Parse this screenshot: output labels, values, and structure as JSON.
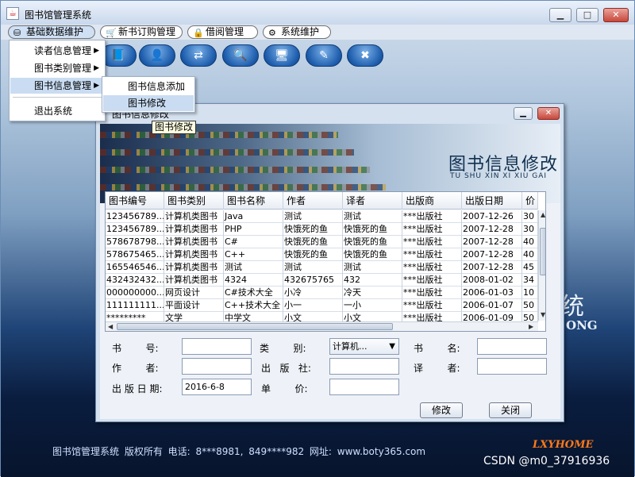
{
  "window": {
    "title": "图书馆管理系统",
    "min_icon": "minimize-icon",
    "max_icon": "maximize-icon",
    "close_icon": "close-icon"
  },
  "menubar": [
    {
      "label": "基础数据维护",
      "icon": "database-icon"
    },
    {
      "label": "新书订购管理",
      "icon": "cart-icon"
    },
    {
      "label": "借阅管理",
      "icon": "lock-icon"
    },
    {
      "label": "系统维护",
      "icon": "gear-icon"
    }
  ],
  "dropdown": {
    "items": [
      "读者信息管理",
      "图书类别管理",
      "图书信息管理",
      "退出系统"
    ],
    "submenu": [
      "图书信息添加",
      "图书修改"
    ]
  },
  "tooltip": "图书修改",
  "toolbar_icons": [
    "book-icon",
    "reader-icon",
    "borrow-icon",
    "search-icon",
    "computer-icon",
    "edit-icon",
    "exit-icon"
  ],
  "background": {
    "title_fragment": "统",
    "latin_fragment": "ONG",
    "footer": "图书馆管理系统   版权所有      电话: 8***8981, 849****982      网址: www.boty365.com",
    "brand": "LXYHOME",
    "watermark": "CSDN @m0_37916936"
  },
  "dialog": {
    "title": "图书信息修改",
    "banner_title": "图书信息修改",
    "banner_subtitle": "TU SHU XIN XI XIU GAI",
    "table": {
      "headers": [
        "图书编号",
        "图书类别",
        "图书名称",
        "作者",
        "译者",
        "出版商",
        "出版日期",
        "价"
      ],
      "rows": [
        [
          "123456789...",
          "计算机类图书",
          "Java",
          "测试",
          "测试",
          "***出版社",
          "2007-12-26",
          "30"
        ],
        [
          "123456789...",
          "计算机类图书",
          "PHP",
          "快饿死的鱼",
          "快饿死的鱼",
          "***出版社",
          "2007-12-28",
          "30"
        ],
        [
          "578678798...",
          "计算机类图书",
          "C#",
          "快饿死的鱼",
          "快饿死的鱼",
          "***出版社",
          "2007-12-28",
          "40"
        ],
        [
          "578675465...",
          "计算机类图书",
          "C++",
          "快饿死的鱼",
          "快饿死的鱼",
          "***出版社",
          "2007-12-28",
          "40"
        ],
        [
          "165546546...",
          "计算机类图书",
          "测试",
          "测试",
          "测试",
          "***出版社",
          "2007-12-28",
          "45"
        ],
        [
          "432432432...",
          "计算机类图书",
          "4324",
          "432675765",
          "432",
          "***出版社",
          "2008-01-02",
          "34"
        ],
        [
          "000000000...",
          "网页设计",
          "C#技术大全",
          "小冷",
          "冷天",
          "***出版社",
          "2006-01-03",
          "10"
        ],
        [
          "111111111...",
          "平面设计",
          "C++技术大全",
          "小一",
          "一小",
          "***出版社",
          "2006-01-07",
          "50"
        ],
        [
          "*********",
          "文学",
          "中学文",
          "小文",
          "小文",
          "***出版社",
          "2006-01-09",
          "50"
        ]
      ]
    },
    "form": {
      "isbn_label": "书        号:",
      "category_label": "类        别:",
      "category_value": "计算机...",
      "name_label": "书        名:",
      "author_label": "作        者:",
      "publisher_label": "出   版   社:",
      "translator_label": "译        者:",
      "date_label": "出 版 日 期:",
      "date_value": "2016-6-8",
      "price_label": "单        价:"
    },
    "buttons": {
      "modify": "修改",
      "close": "关闭"
    }
  }
}
